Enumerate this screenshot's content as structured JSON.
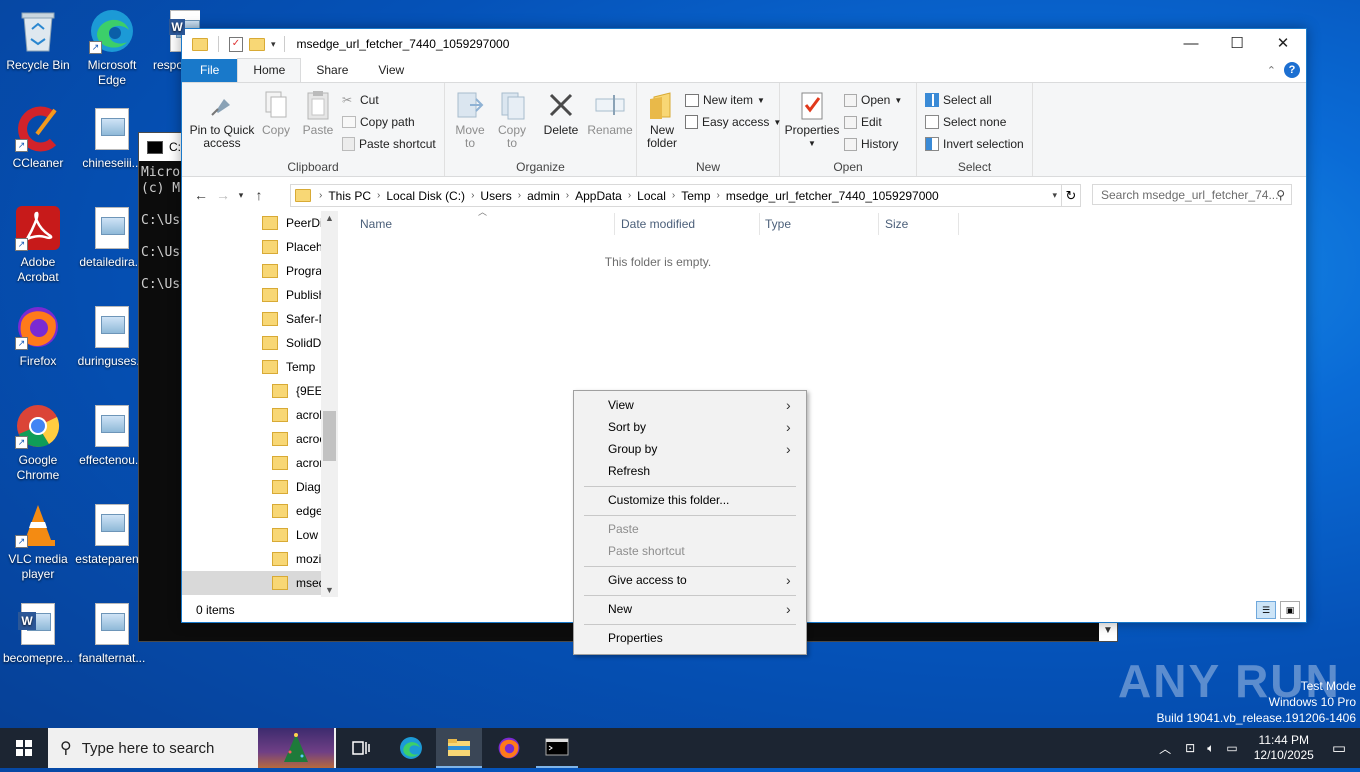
{
  "desktop": {
    "icons": [
      {
        "label": "Recycle Bin"
      },
      {
        "label": "Microsoft Edge"
      },
      {
        "label": "respo"
      },
      {
        "label": "CCleaner"
      },
      {
        "label": "chineseiii..."
      },
      {
        "label": "Adobe Acrobat"
      },
      {
        "label": "detailedira..."
      },
      {
        "label": "Firefox"
      },
      {
        "label": "duringuses..."
      },
      {
        "label": "Google Chrome"
      },
      {
        "label": "effectenou..."
      },
      {
        "label": "VLC media player"
      },
      {
        "label": "estateparen..."
      },
      {
        "label": "becomepre..."
      },
      {
        "label": "fanalternat..."
      }
    ]
  },
  "cmd": {
    "title": "C:\\",
    "lines": [
      "Micros",
      "(c) Mi",
      "",
      "C:\\Use",
      "",
      "C:\\Use",
      "",
      "C:\\Use"
    ]
  },
  "explorer": {
    "title": "msedge_url_fetcher_7440_1059297000",
    "tabs": {
      "file": "File",
      "home": "Home",
      "share": "Share",
      "view": "View"
    },
    "ribbon": {
      "clipboard": {
        "pin": "Pin to Quick access",
        "copy": "Copy",
        "paste": "Paste",
        "cut": "Cut",
        "copy_path": "Copy path",
        "paste_shortcut": "Paste shortcut",
        "label": "Clipboard"
      },
      "organize": {
        "move_to": "Move to",
        "copy_to": "Copy to",
        "delete": "Delete",
        "rename": "Rename",
        "label": "Organize"
      },
      "new": {
        "new_folder": "New folder",
        "new_item": "New item",
        "easy_access": "Easy access",
        "label": "New"
      },
      "open": {
        "properties": "Properties",
        "open": "Open",
        "edit": "Edit",
        "history": "History",
        "label": "Open"
      },
      "select": {
        "select_all": "Select all",
        "select_none": "Select none",
        "invert": "Invert selection",
        "label": "Select"
      }
    },
    "address": {
      "crumbs": [
        "This PC",
        "Local Disk (C:)",
        "Users",
        "admin",
        "AppData",
        "Local",
        "Temp",
        "msedge_url_fetcher_7440_1059297000"
      ],
      "search_placeholder": "Search msedge_url_fetcher_74..."
    },
    "tree": [
      {
        "label": "PeerDis"
      },
      {
        "label": "Placeho"
      },
      {
        "label": "Prograr"
      },
      {
        "label": "Publish"
      },
      {
        "label": "Safer-N"
      },
      {
        "label": "SolidDc"
      },
      {
        "label": "Temp"
      },
      {
        "label": "{9EE2!"
      },
      {
        "label": "acrob"
      },
      {
        "label": "acroc"
      },
      {
        "label": "acrord"
      },
      {
        "label": "Diagn"
      },
      {
        "label": "edge_"
      },
      {
        "label": "Low"
      },
      {
        "label": "mozil"
      },
      {
        "label": "msed"
      }
    ],
    "columns": {
      "name": "Name",
      "date_modified": "Date modified",
      "type": "Type",
      "size": "Size"
    },
    "empty_message": "This folder is empty.",
    "status": "0 items"
  },
  "context_menu": {
    "view": "View",
    "sort_by": "Sort by",
    "group_by": "Group by",
    "refresh": "Refresh",
    "customize": "Customize this folder...",
    "paste": "Paste",
    "paste_shortcut": "Paste shortcut",
    "give_access": "Give access to",
    "new": "New",
    "properties": "Properties"
  },
  "taskbar": {
    "search_placeholder": "Type here to search",
    "time": "11:44 PM",
    "date": "12/10/2025"
  },
  "watermark": {
    "line1": "Test Mode",
    "line2": "Windows 10 Pro",
    "line3": "Build 19041.vb_release.191206-1406",
    "brand": "ANY RUN"
  }
}
